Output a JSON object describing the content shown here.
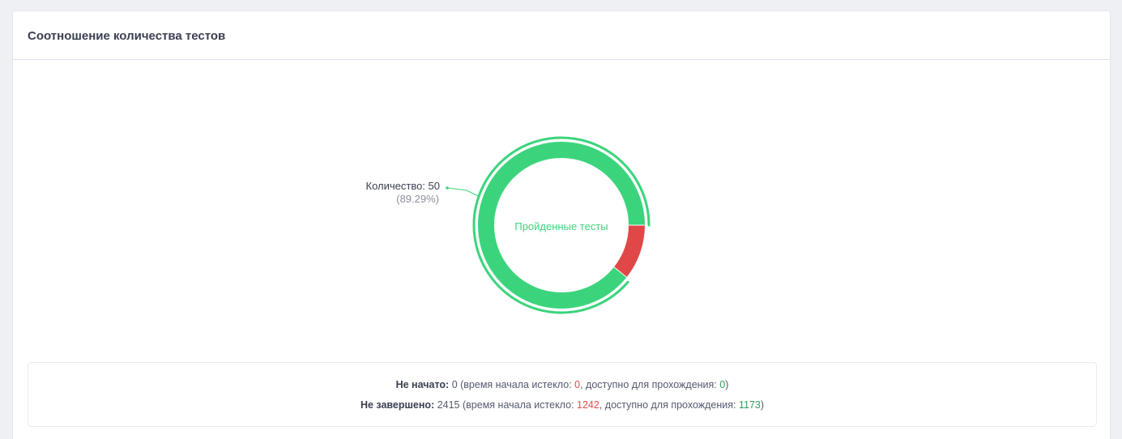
{
  "card": {
    "title": "Соотношение количества тестов"
  },
  "chart_data": {
    "type": "pie",
    "center_label": "Пройденные тесты",
    "slices": [
      {
        "name": "Пройденные тесты",
        "value": 50,
        "percent": 89.29,
        "color": "#3bd47c"
      },
      {
        "value": 6,
        "percent": 10.71,
        "color": "#e04848"
      }
    ],
    "tooltip": {
      "count_label": "Количество: 50",
      "percent_label": "(89.29%)"
    }
  },
  "stats": {
    "not_started": {
      "label": "Не начато:",
      "value": "0",
      "expired_label": "(время начала истекло:",
      "expired_value": "0",
      "available_label": ", доступно для прохождения:",
      "available_value": "0",
      "close": ")"
    },
    "not_finished": {
      "label": "Не завершено:",
      "value": "2415",
      "expired_label": "(время начала истекло:",
      "expired_value": "1242",
      "available_label": ", доступно для прохождения:",
      "available_value": "1173",
      "close": ")"
    }
  },
  "colors": {
    "passed": "#3bd47c",
    "failed": "#e04848",
    "text_red": "#e34b4b",
    "text_green": "#2f9e5f"
  }
}
